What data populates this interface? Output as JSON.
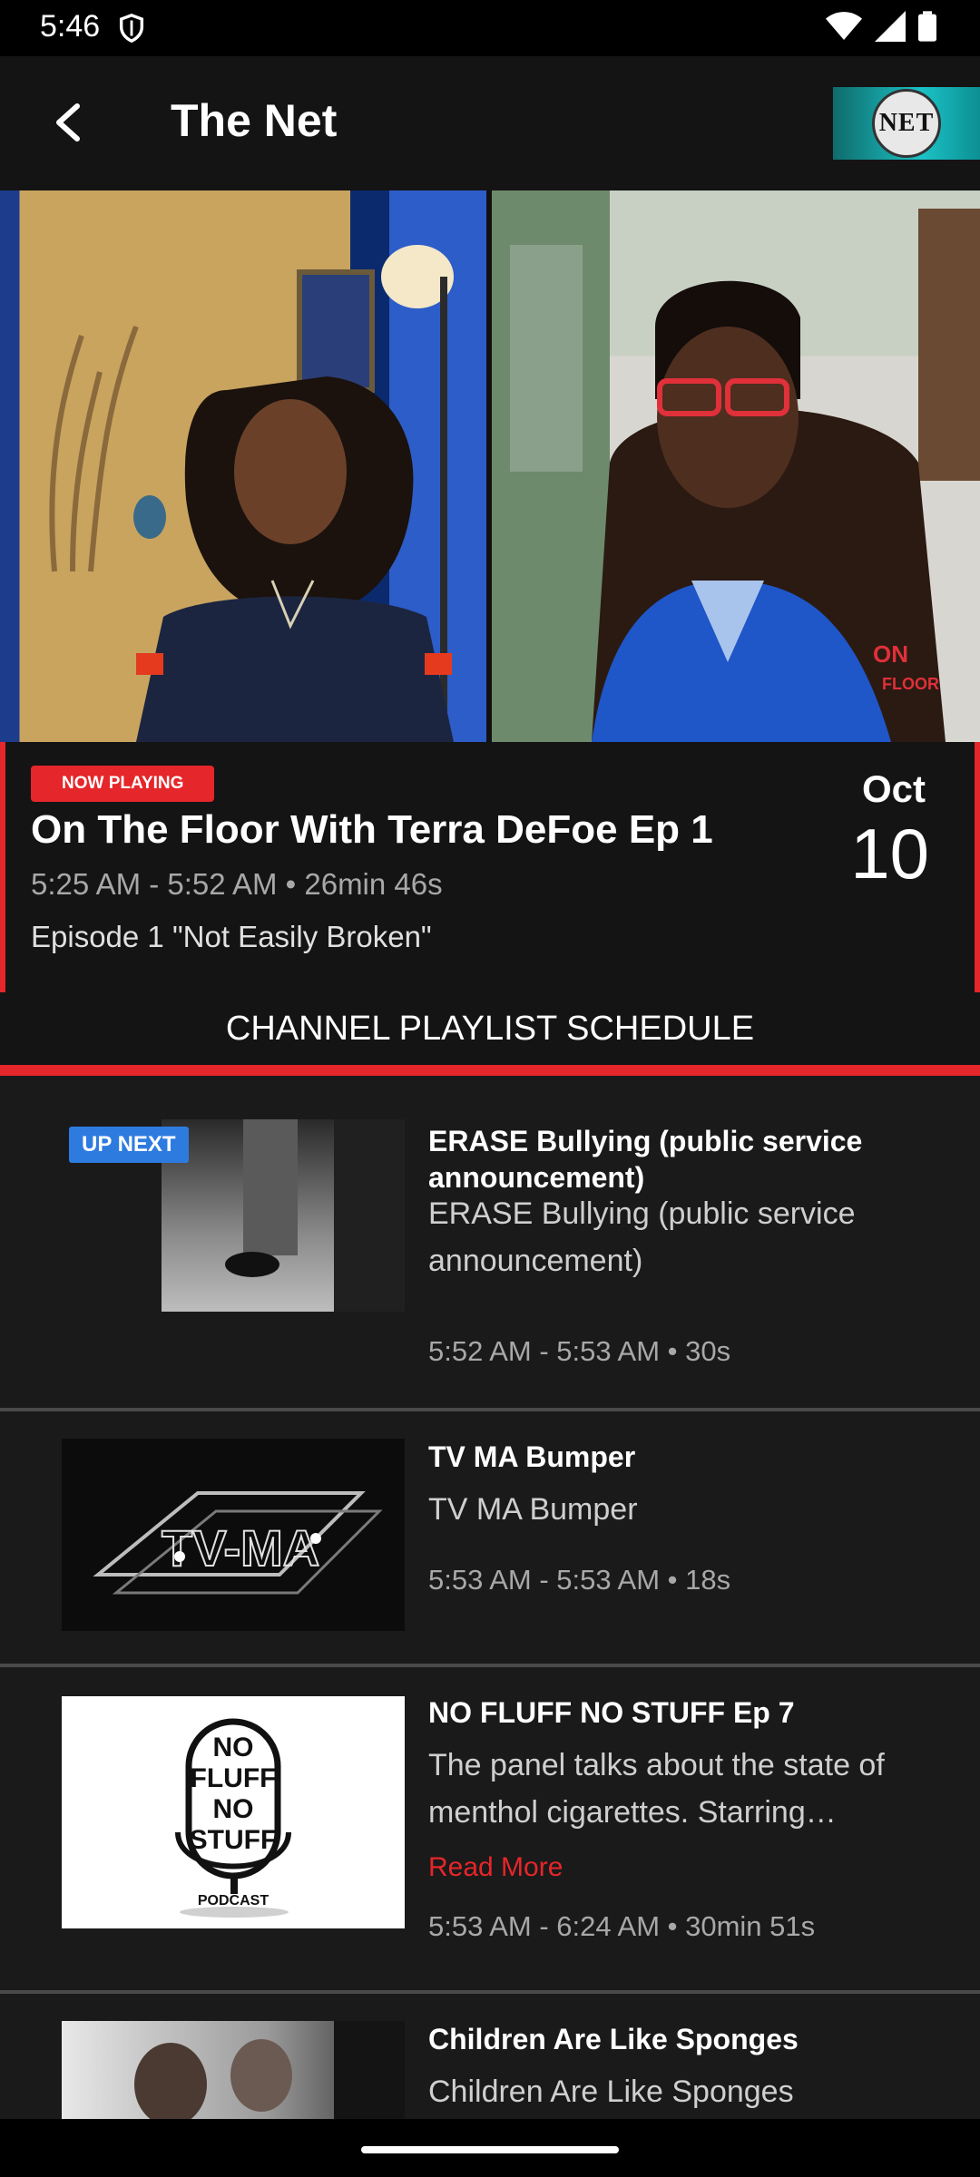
{
  "status_bar": {
    "time": "5:46"
  },
  "app_bar": {
    "title": "The Net",
    "logo_text": "THE NET"
  },
  "now_playing": {
    "badge": "NOW PLAYING",
    "title": "On The Floor With Terra DeFoe Ep 1",
    "time": "5:25 AM - 5:52 AM • 26min 46s",
    "description": "Episode 1 \"Not Easily Broken\"",
    "month": "Oct",
    "day": "10"
  },
  "schedule": {
    "header": "CHANNEL PLAYLIST SCHEDULE",
    "items": [
      {
        "badge": "UP NEXT",
        "title": "ERASE Bullying (public service announcement)",
        "description": "ERASE Bullying (public service announcement)",
        "time": "5:52 AM - 5:53 AM • 30s"
      },
      {
        "title": "TV MA Bumper",
        "description": "TV MA Bumper",
        "time": "5:53 AM - 5:53 AM • 18s"
      },
      {
        "title": "NO FLUFF NO STUFF Ep 7",
        "description": "The panel talks about the state of menthol cigarettes. Starring…",
        "read_more": "Read More",
        "time": "5:53 AM - 6:24 AM • 30min 51s",
        "thumb_text": [
          "NO",
          "FLUFF",
          "NO",
          "STUFF"
        ],
        "thumb_caption": "PODCAST"
      },
      {
        "title": "Children Are Like Sponges",
        "description": "Children Are Like Sponges"
      }
    ]
  }
}
